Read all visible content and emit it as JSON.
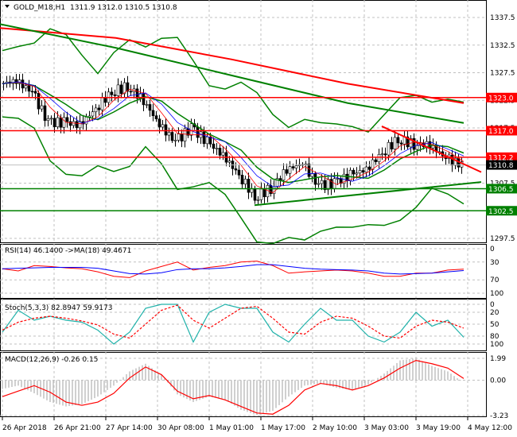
{
  "header": {
    "symbol": "GOLD_M18,H1",
    "ohlc": "1311.9 1312.0 1310.5 1310.8"
  },
  "colors": {
    "bull": "#000000",
    "bear": "#000000",
    "red": "#ff0000",
    "green": "#008000",
    "blue": "#0000ff",
    "stoch": "#20b2aa",
    "hist": "#c0c0c0",
    "grid": "#c0c0c0"
  },
  "chart_data": [
    {
      "type": "candlestick",
      "title": "GOLD_M18,H1",
      "ylim": [
        1297.5,
        1337.5
      ],
      "y_ticks": [
        "1337.5",
        "1332.5",
        "1327.5",
        "1322.5",
        "1317.5",
        "1307.5",
        "1297.5"
      ],
      "x_ticks": [
        "26 Apr 2018",
        "26 Apr 21:00",
        "27 Apr 14:00",
        "30 Apr 08:00",
        "1 May 01:00",
        "1 May 17:00",
        "2 May 10:00",
        "3 May 03:00",
        "3 May 19:00",
        "4 May 12:00"
      ],
      "close": [
        1325.5,
        1326,
        1324,
        1318.5,
        1318.5,
        1318,
        1321,
        1324,
        1325,
        1322.5,
        1318,
        1315,
        1317.5,
        1315,
        1312.5,
        1309,
        1305,
        1306.5,
        1310,
        1311,
        1307,
        1307.5,
        1309,
        1310,
        1313,
        1315.5,
        1314.5,
        1314.5,
        1312,
        1310.8
      ],
      "ma_long_red": [
        1335.6,
        1333.8,
        1329.9,
        1325.5,
        1322.0
      ],
      "ma_long_green": [
        1336.3,
        1332,
        1327,
        1322,
        1318.4
      ],
      "levels": [
        {
          "value": 1323.0,
          "label": "1323.0",
          "color": "red"
        },
        {
          "value": 1317.0,
          "label": "1317.0",
          "color": "red"
        },
        {
          "value": 1312.2,
          "label": "1312.2",
          "color": "red"
        },
        {
          "value": 1306.5,
          "label": "1306.5",
          "color": "green"
        },
        {
          "value": 1302.5,
          "label": "1302.5",
          "color": "green"
        }
      ],
      "current": {
        "value": 1310.8,
        "label": "1310.8"
      },
      "trendlines": [
        {
          "color": "red",
          "from": [
            24,
            1317.8
          ],
          "to": [
            30,
            1309.5
          ]
        },
        {
          "color": "green",
          "from": [
            16,
            1303.5
          ],
          "to": [
            30,
            1307.7
          ]
        }
      ]
    },
    {
      "type": "line",
      "label": "RSI(14) 46.1400  ->MA(18) 49.4671",
      "ylim": [
        0,
        100
      ],
      "y_ticks": [
        "100",
        "70",
        "30",
        "0"
      ],
      "series": [
        {
          "name": "RSI(14)",
          "color": "red",
          "values": [
            45,
            50,
            38,
            40,
            43,
            45,
            52,
            62,
            65,
            50,
            40,
            30,
            48,
            42,
            38,
            30,
            28,
            38,
            55,
            52,
            50,
            48,
            50,
            55,
            62,
            62,
            55,
            55,
            48,
            46
          ]
        },
        {
          "name": "MA(18)",
          "color": "blue",
          "values": [
            45,
            44,
            43,
            42,
            42,
            42,
            44,
            50,
            56,
            57,
            54,
            47,
            45,
            45,
            43,
            40,
            36,
            36,
            40,
            44,
            46,
            47,
            48,
            50,
            55,
            57,
            56,
            55,
            52,
            49
          ]
        }
      ]
    },
    {
      "type": "line",
      "label": "Stoch(5,3,3) 82.8947 59.9173",
      "ylim": [
        0,
        100
      ],
      "y_ticks": [
        "100",
        "80",
        "50",
        "20",
        "0"
      ],
      "series": [
        {
          "color": "stoch",
          "values": [
            70,
            15,
            40,
            30,
            40,
            45,
            65,
            100,
            70,
            10,
            0,
            0,
            95,
            20,
            0,
            10,
            10,
            70,
            95,
            50,
            10,
            40,
            40,
            80,
            95,
            70,
            20,
            55,
            40,
            83
          ]
        },
        {
          "color": "red",
          "dashed": true,
          "values": [
            65,
            45,
            35,
            30,
            35,
            42,
            52,
            75,
            85,
            50,
            15,
            2,
            40,
            60,
            35,
            10,
            5,
            35,
            70,
            75,
            45,
            30,
            35,
            55,
            80,
            85,
            55,
            40,
            45,
            60
          ]
        }
      ]
    },
    {
      "type": "bar+line",
      "label": "MACD(12,26,9) -0.26 0.15",
      "ylim": [
        -3.23,
        1.99
      ],
      "y_ticks": [
        "1.99",
        "0.00",
        "-3.23"
      ],
      "histogram": [
        -0.8,
        -0.5,
        -1.2,
        -2.0,
        -2.4,
        -2.2,
        -1.5,
        -0.5,
        0.8,
        1.5,
        0.5,
        -1.3,
        -2.0,
        -1.5,
        -1.8,
        -2.7,
        -3.2,
        -2.8,
        -1.5,
        -0.5,
        -0.3,
        -0.7,
        -0.9,
        -0.4,
        0.6,
        1.8,
        2.0,
        1.3,
        0.8,
        -0.26
      ],
      "signal": [
        -1.5,
        -1.0,
        -0.5,
        -1.1,
        -2.0,
        -2.3,
        -2.0,
        -1.2,
        0.2,
        1.2,
        0.5,
        -1.0,
        -1.7,
        -1.4,
        -1.8,
        -2.4,
        -3.0,
        -3.1,
        -2.3,
        -0.9,
        -0.3,
        -0.5,
        -0.9,
        -0.5,
        0.2,
        1.1,
        1.8,
        1.5,
        1.1,
        0.15
      ]
    }
  ]
}
